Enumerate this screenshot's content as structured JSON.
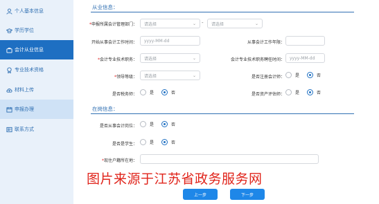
{
  "sidebar": {
    "items": [
      {
        "label": "个人基本信息",
        "icon": "user-icon"
      },
      {
        "label": "学历学位",
        "icon": "graduation-cap-icon"
      },
      {
        "label": "会计从业信息",
        "icon": "briefcase-icon",
        "active": true
      },
      {
        "label": "专业技术资格",
        "icon": "certificate-icon"
      },
      {
        "label": "材料上传",
        "icon": "cloud-upload-icon"
      },
      {
        "label": "申报办理",
        "icon": "calendar-icon",
        "highlight": true
      },
      {
        "label": "联系方式",
        "icon": "contact-card-icon"
      }
    ]
  },
  "sections": {
    "employment": "从业信息：",
    "working": "在岗信息："
  },
  "form": {
    "dept_label": "申报所属会计管理部门：",
    "dept_select1": "请选择",
    "dept_select2": "请选择",
    "dept_dash": "-",
    "start_date_label": "开始从事会计工作时间：",
    "start_date_placeholder": "yyyy-MM-dd",
    "years_label": "从事会计工作年限：",
    "title_label": "会计专业技术职务：",
    "title_select": "请选择",
    "title_date_label": "会计专业技术职务聘任时间：",
    "title_date_placeholder": "yyyy-MM-dd",
    "rank_label": "领导等级：",
    "rank_select": "请选择",
    "cpa_label": "是否注册会计师：",
    "tax_label": "是否税务师：",
    "assessor_label": "是否资产评估师：",
    "on_duty_label": "是否从事会计岗位：",
    "student_label": "是否是学生：",
    "residence_label": "现住户籍所在地：",
    "yes": "是",
    "no": "否"
  },
  "buttons": {
    "prev": "上一步",
    "next": "下一步"
  },
  "watermark": "图片来源于江苏省政务服务网",
  "colors": {
    "accent": "#1e6fc2",
    "button": "#1e87e8",
    "sidebar_bg": "#e9f1fa",
    "watermark": "#e0241b"
  }
}
